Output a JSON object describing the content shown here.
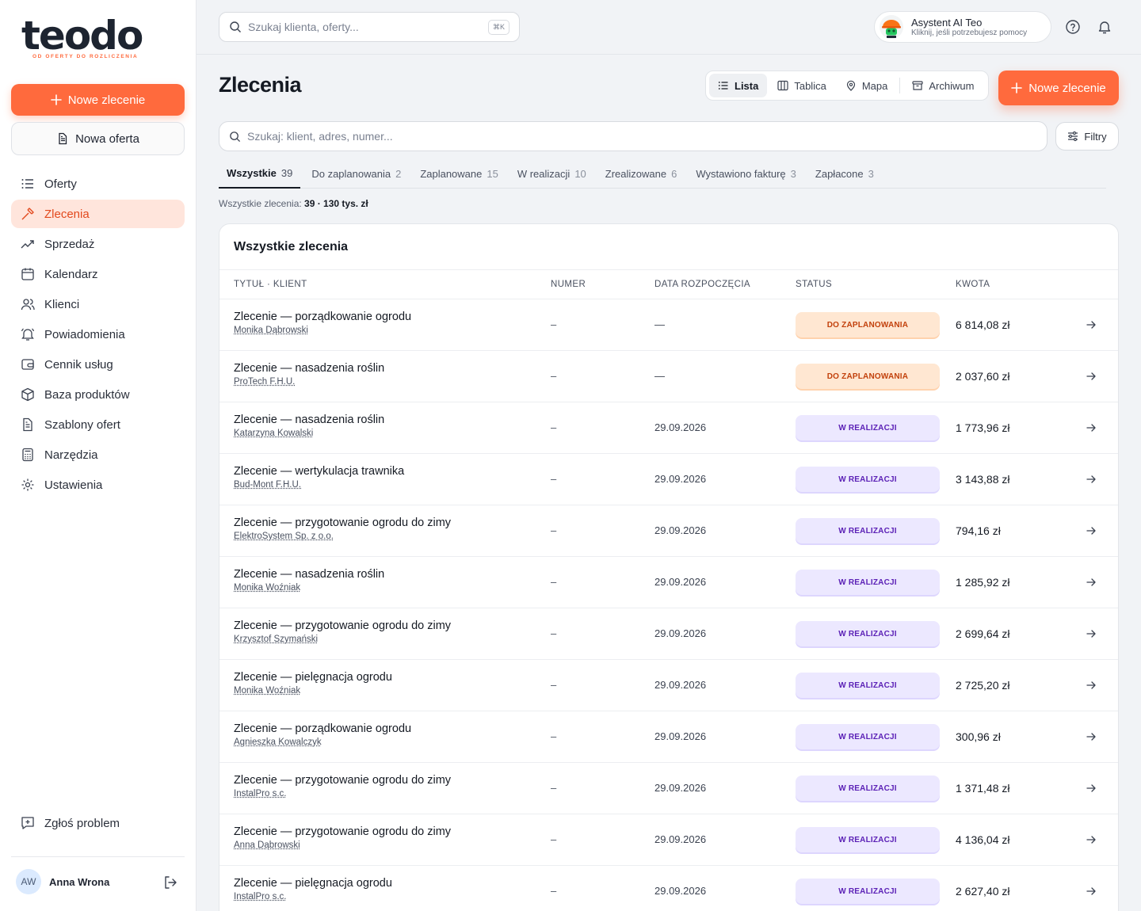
{
  "brand": {
    "logo_text": "teodo",
    "logo_tagline": "OD OFERTY DO ROZLICZENIA",
    "accent": "#ff6a3d"
  },
  "sidebar": {
    "new_order": "Nowe zlecenie",
    "new_offer": "Nowa oferta",
    "items": [
      {
        "label": "Oferty",
        "icon": "list-icon"
      },
      {
        "label": "Zlecenia",
        "icon": "hammer-icon",
        "active": true
      },
      {
        "label": "Sprzedaż",
        "icon": "trend-icon"
      },
      {
        "label": "Kalendarz",
        "icon": "calendar-icon"
      },
      {
        "label": "Klienci",
        "icon": "users-icon"
      },
      {
        "label": "Powiadomienia",
        "icon": "bell-ring-icon"
      },
      {
        "label": "Cennik usług",
        "icon": "wallet-icon"
      },
      {
        "label": "Baza produktów",
        "icon": "box-icon"
      },
      {
        "label": "Szablony ofert",
        "icon": "document-icon"
      },
      {
        "label": "Narzędzia",
        "icon": "calculator-icon"
      },
      {
        "label": "Ustawienia",
        "icon": "gear-icon"
      }
    ],
    "report": "Zgłoś problem",
    "user": {
      "initials": "AW",
      "name": "Anna Wrona"
    }
  },
  "topbar": {
    "search_placeholder": "Szukaj klienta, oferty...",
    "shortcut": "⌘K",
    "assistant_title": "Asystent AI Teo",
    "assistant_sub": "Kliknij, jeśli potrzebujesz pomocy"
  },
  "page": {
    "title": "Zlecenia",
    "views": [
      "Lista",
      "Tablica",
      "Mapa",
      "Archiwum"
    ],
    "new_button": "Nowe zlecenie",
    "search_placeholder": "Szukaj: klient, adres, numer...",
    "filters": "Filtry",
    "tabs": [
      {
        "label": "Wszystkie",
        "count": "39"
      },
      {
        "label": "Do zaplanowania",
        "count": "2"
      },
      {
        "label": "Zaplanowane",
        "count": "15"
      },
      {
        "label": "W realizacji",
        "count": "10"
      },
      {
        "label": "Zrealizowane",
        "count": "6"
      },
      {
        "label": "Wystawiono fakturę",
        "count": "3"
      },
      {
        "label": "Zapłacone",
        "count": "3"
      }
    ],
    "summary_label": "Wszystkie zlecenia:",
    "summary_value": "39 · 130 tys. zł"
  },
  "table": {
    "title": "Wszystkie zlecenia",
    "headers": {
      "title": "TYTUŁ · KLIENT",
      "number": "NUMER",
      "date": "DATA ROZPOCZĘCIA",
      "status": "STATUS",
      "amount": "KWOTA"
    },
    "rows": [
      {
        "title": "Zlecenie — porządkowanie ogrodu",
        "client": "Monika Dąbrowski",
        "number": "–",
        "date": "—",
        "status": "DO ZAPLANOWANIA",
        "kind": "plan",
        "amount": "6 814,08 zł"
      },
      {
        "title": "Zlecenie — nasadzenia roślin",
        "client": "ProTech F.H.U.",
        "number": "–",
        "date": "—",
        "status": "DO ZAPLANOWANIA",
        "kind": "plan",
        "amount": "2 037,60 zł"
      },
      {
        "title": "Zlecenie — nasadzenia roślin",
        "client": "Katarzyna Kowalski",
        "number": "–",
        "date": "29.09.2026",
        "status": "W REALIZACJI",
        "kind": "real",
        "amount": "1 773,96 zł"
      },
      {
        "title": "Zlecenie — wertykulacja trawnika",
        "client": "Bud-Mont F.H.U.",
        "number": "–",
        "date": "29.09.2026",
        "status": "W REALIZACJI",
        "kind": "real",
        "amount": "3 143,88 zł"
      },
      {
        "title": "Zlecenie — przygotowanie ogrodu do zimy",
        "client": "ElektroSystem Sp. z o.o.",
        "number": "–",
        "date": "29.09.2026",
        "status": "W REALIZACJI",
        "kind": "real",
        "amount": "794,16 zł"
      },
      {
        "title": "Zlecenie — nasadzenia roślin",
        "client": "Monika Woźniak",
        "number": "–",
        "date": "29.09.2026",
        "status": "W REALIZACJI",
        "kind": "real",
        "amount": "1 285,92 zł"
      },
      {
        "title": "Zlecenie — przygotowanie ogrodu do zimy",
        "client": "Krzysztof Szymański",
        "number": "–",
        "date": "29.09.2026",
        "status": "W REALIZACJI",
        "kind": "real",
        "amount": "2 699,64 zł"
      },
      {
        "title": "Zlecenie — pielęgnacja ogrodu",
        "client": "Monika Woźniak",
        "number": "–",
        "date": "29.09.2026",
        "status": "W REALIZACJI",
        "kind": "real",
        "amount": "2 725,20 zł"
      },
      {
        "title": "Zlecenie — porządkowanie ogrodu",
        "client": "Agnieszka Kowalczyk",
        "number": "–",
        "date": "29.09.2026",
        "status": "W REALIZACJI",
        "kind": "real",
        "amount": "300,96 zł"
      },
      {
        "title": "Zlecenie — przygotowanie ogrodu do zimy",
        "client": "InstalPro s.c.",
        "number": "–",
        "date": "29.09.2026",
        "status": "W REALIZACJI",
        "kind": "real",
        "amount": "1 371,48 zł"
      },
      {
        "title": "Zlecenie — przygotowanie ogrodu do zimy",
        "client": "Anna Dąbrowski",
        "number": "–",
        "date": "29.09.2026",
        "status": "W REALIZACJI",
        "kind": "real",
        "amount": "4 136,04 zł"
      },
      {
        "title": "Zlecenie — pielęgnacja ogrodu",
        "client": "InstalPro s.c.",
        "number": "–",
        "date": "29.09.2026",
        "status": "W REALIZACJI",
        "kind": "real",
        "amount": "2 627,40 zł"
      }
    ]
  }
}
